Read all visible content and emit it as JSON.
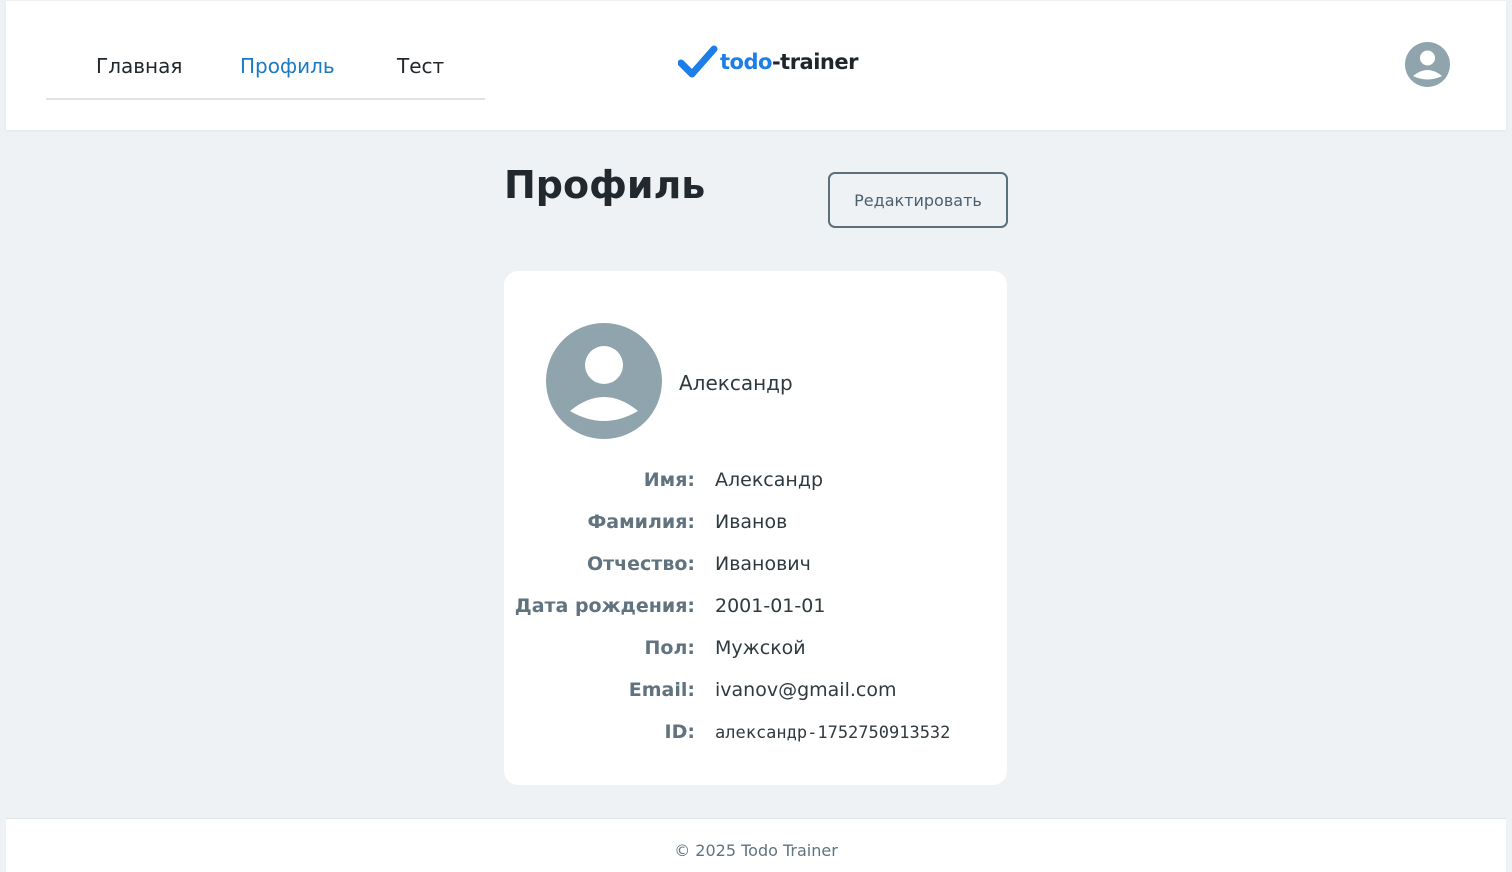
{
  "nav": {
    "items": [
      {
        "label": "Главная",
        "active": false
      },
      {
        "label": "Профиль",
        "active": true
      },
      {
        "label": "Тест",
        "active": false
      }
    ]
  },
  "logo": {
    "part1": "todo",
    "part2": "-trainer",
    "icon": "checkmark-icon"
  },
  "header": {
    "avatar_icon": "user-avatar-icon"
  },
  "page": {
    "title": "Профиль",
    "edit_label": "Редактировать"
  },
  "profile": {
    "display_name": "Александр",
    "fields": [
      {
        "label": "Имя:",
        "value": "Александр"
      },
      {
        "label": "Фамилия:",
        "value": "Иванов"
      },
      {
        "label": "Отчество:",
        "value": "Иванович"
      },
      {
        "label": "Дата рождения:",
        "value": "2001-01-01"
      },
      {
        "label": "Пол:",
        "value": "Мужской"
      },
      {
        "label": "Email:",
        "value": "ivanov@gmail.com"
      },
      {
        "label": "ID:",
        "value": "александр-1752750913532"
      }
    ]
  },
  "footer": {
    "text": "© 2025 Todo Trainer"
  },
  "colors": {
    "accent": "#1a7bc2",
    "logo_blue": "#1c7ee6",
    "background": "#eef2f5",
    "avatar": "#90a4ae",
    "label": "#60737f"
  }
}
